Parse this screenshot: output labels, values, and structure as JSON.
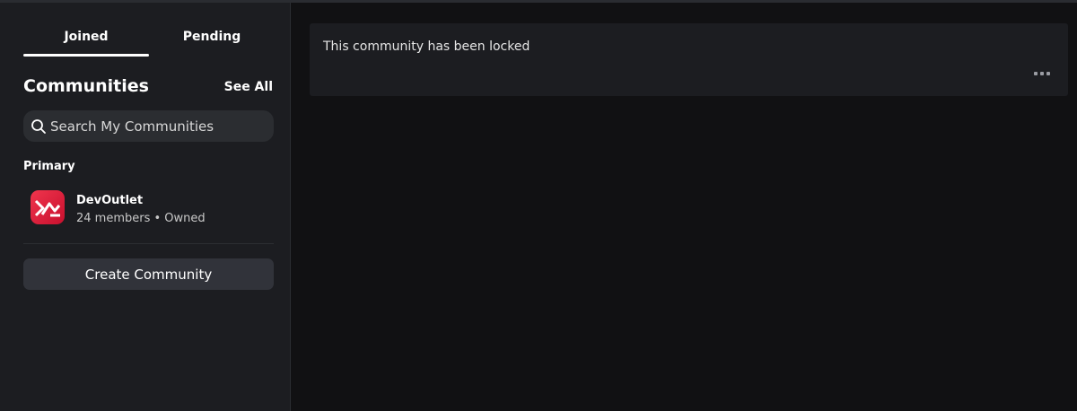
{
  "tabs": [
    {
      "label": "Joined",
      "active": true
    },
    {
      "label": "Pending",
      "active": false
    }
  ],
  "sidebar": {
    "section_title": "Communities",
    "see_all_label": "See All",
    "search": {
      "placeholder": "Search My Communities",
      "value": ""
    },
    "group_label": "Primary",
    "communities": [
      {
        "name": "DevOutlet",
        "meta": "24 members • Owned",
        "icon": "devoutlet-logo-icon"
      }
    ],
    "create_label": "Create Community"
  },
  "main": {
    "message": "This community has been locked"
  },
  "colors": {
    "background": "#111113",
    "panel": "#1c1d21",
    "input": "#2b2d31",
    "button": "#31333a",
    "brand": "#e8243f"
  }
}
